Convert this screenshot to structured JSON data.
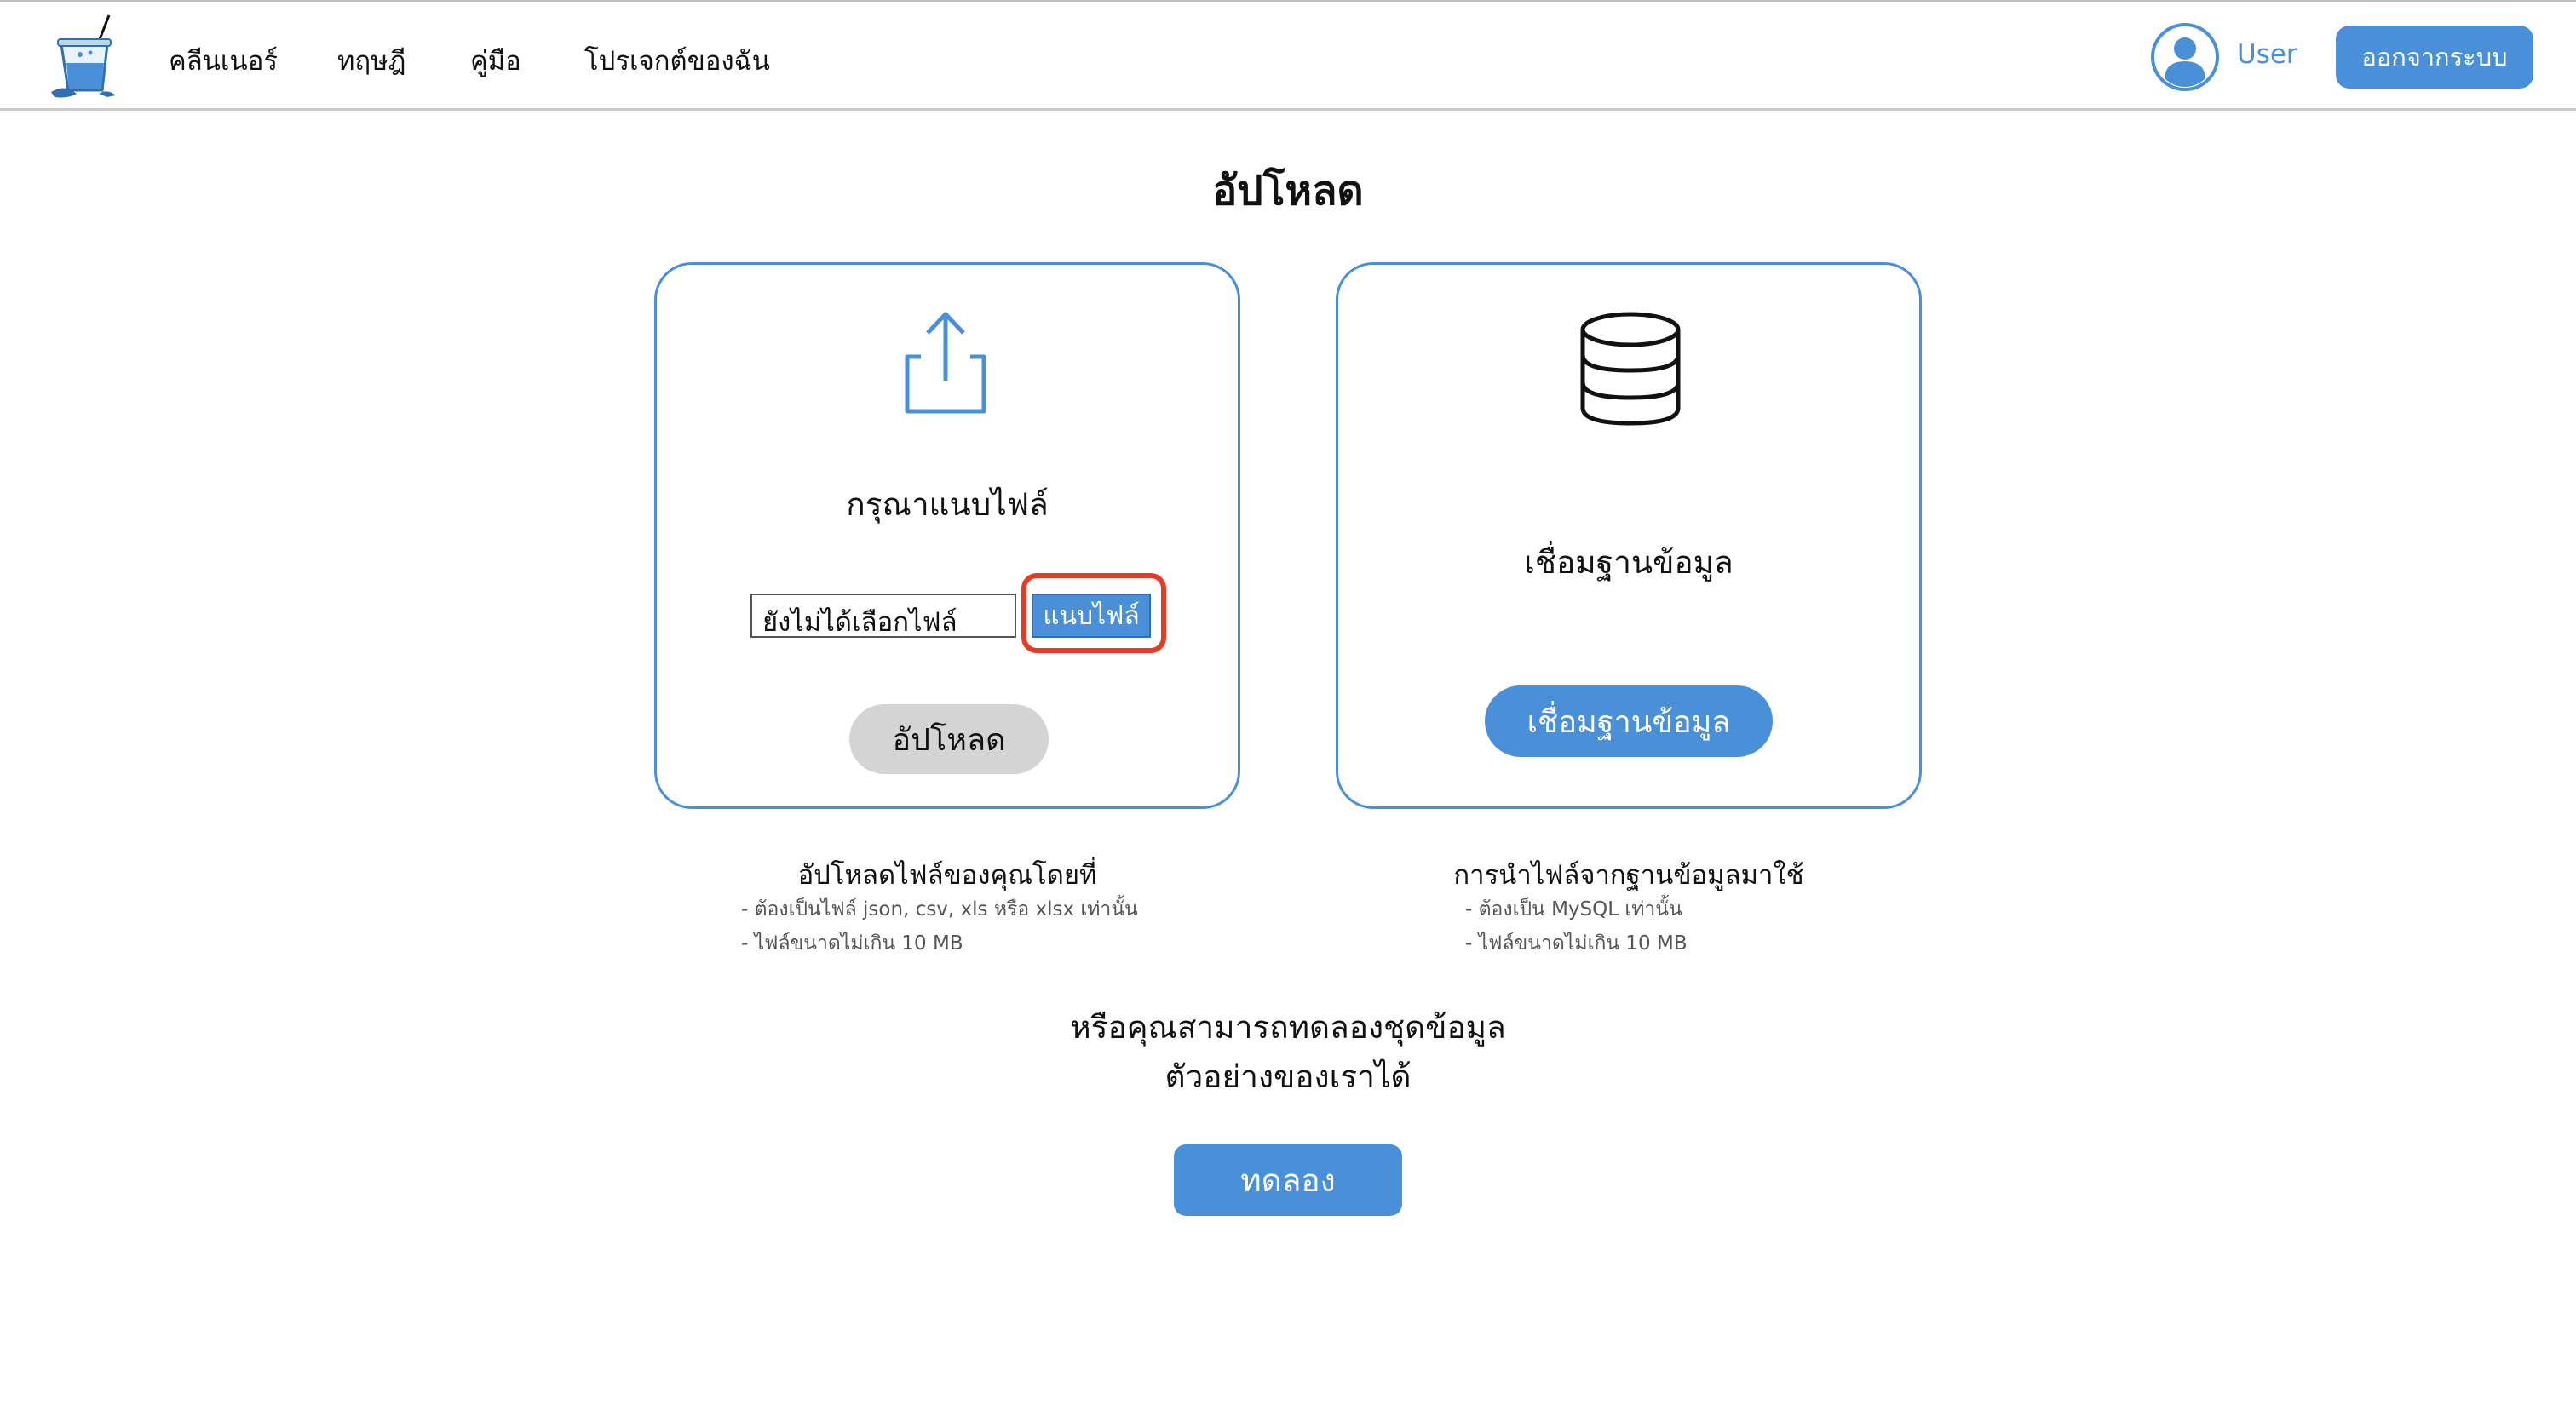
{
  "nav": {
    "links": [
      "คลีนเนอร์",
      "ทฤษฎี",
      "คู่มือ",
      "โปรเจกต์ของฉัน"
    ],
    "user_label": "User",
    "logout_label": "ออกจากระบบ"
  },
  "page": {
    "title": "อัปโหลด"
  },
  "upload_card": {
    "heading": "กรุณาแนบไฟล์",
    "file_status": "ยังไม่ได้เลือกไฟล์",
    "attach_label": "แนบไฟล์",
    "upload_label": "อัปโหลด"
  },
  "db_card": {
    "heading": "เชื่อมฐานข้อมูล",
    "connect_label": "เชื่อมฐานข้อมูล"
  },
  "upload_desc": {
    "title": "อัปโหลดไฟล์ของคุณโดยที่",
    "lines": [
      "- ต้องเป็นไฟล์ json, csv, xls หรือ xlsx เท่านั้น",
      "- ไฟล์ขนาดไม่เกิน 10 MB"
    ]
  },
  "db_desc": {
    "title": "การนำไฟล์จากฐานข้อมูลมาใช้",
    "lines": [
      "- ต้องเป็น MySQL เท่านั้น",
      "- ไฟล์ขนาดไม่เกิน 10 MB"
    ]
  },
  "sample": {
    "line1": "หรือคุณสามารถทดลองชุดข้อมูล",
    "line2": "ตัวอย่างของเราได้",
    "try_label": "ทดลอง"
  },
  "colors": {
    "accent": "#4a90d9",
    "highlight": "#e53a24",
    "button_gray": "#d4d4d4"
  },
  "icons": {
    "logo": "cleaner-cup-logo-icon",
    "avatar": "user-avatar-icon",
    "upload": "upload-icon",
    "database": "database-icon"
  }
}
